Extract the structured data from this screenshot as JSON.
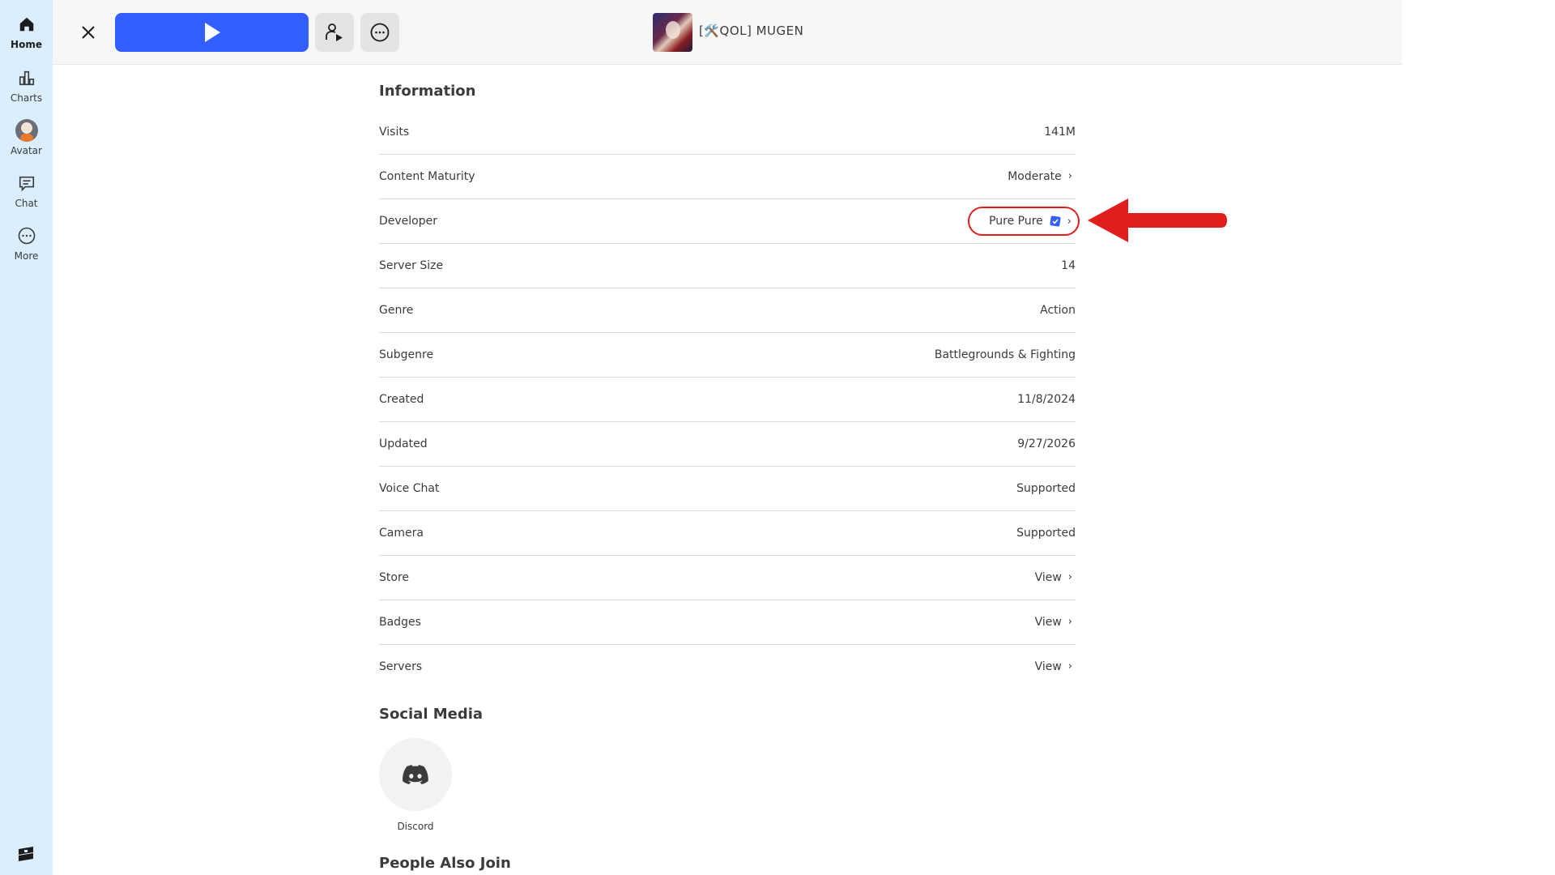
{
  "sidebar": {
    "items": [
      {
        "label": "Home",
        "icon": "home-icon"
      },
      {
        "label": "Charts",
        "icon": "charts-icon"
      },
      {
        "label": "Avatar",
        "icon": "avatar-icon"
      },
      {
        "label": "Chat",
        "icon": "chat-icon"
      },
      {
        "label": "More",
        "icon": "more-icon"
      }
    ],
    "active": "Home"
  },
  "topbar": {
    "game_title": "[🛠️QOL] MUGEN"
  },
  "information": {
    "title": "Information",
    "rows": [
      {
        "key": "Visits",
        "value": "141M"
      },
      {
        "key": "Content Maturity",
        "value": "Moderate"
      },
      {
        "key": "Developer",
        "value": "Pure Pure"
      },
      {
        "key": "Server Size",
        "value": "14"
      },
      {
        "key": "Genre",
        "value": "Action"
      },
      {
        "key": "Subgenre",
        "value": "Battlegrounds & Fighting"
      },
      {
        "key": "Created",
        "value": "11/8/2024"
      },
      {
        "key": "Updated",
        "value": "9/27/2026"
      },
      {
        "key": "Voice Chat",
        "value": "Supported"
      },
      {
        "key": "Camera",
        "value": "Supported"
      },
      {
        "key": "Store",
        "value": "View"
      },
      {
        "key": "Badges",
        "value": "View"
      },
      {
        "key": "Servers",
        "value": "View"
      }
    ]
  },
  "social": {
    "title": "Social Media",
    "discord_label": "Discord"
  },
  "people_also_join": {
    "title": "People Also Join"
  },
  "colors": {
    "sidebar_bg": "#dbeefe",
    "play_button": "#335fff",
    "highlight": "#e01e1e",
    "verified_badge": "#335fff"
  }
}
